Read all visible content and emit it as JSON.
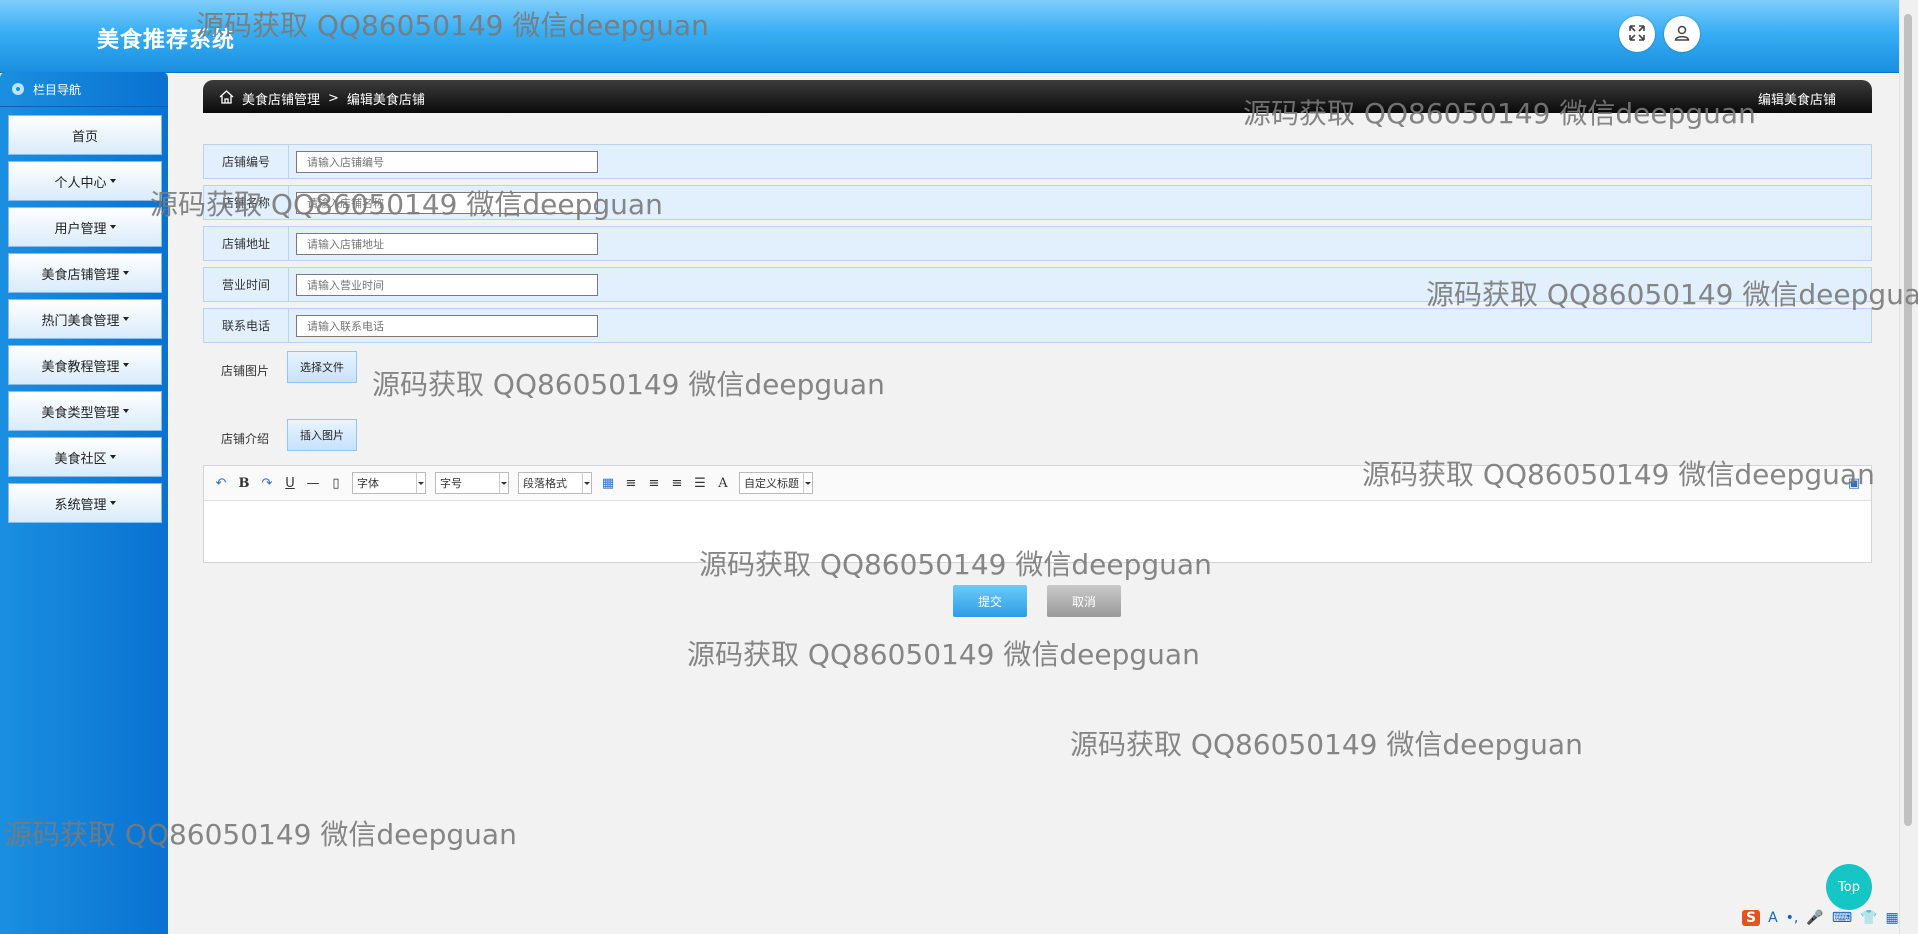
{
  "header": {
    "title": "美食推荐系统"
  },
  "sidebar": {
    "heading": "栏目导航",
    "items": [
      {
        "label": "首页",
        "dropdown": false
      },
      {
        "label": "个人中心",
        "dropdown": true
      },
      {
        "label": "用户管理",
        "dropdown": true
      },
      {
        "label": "美食店铺管理",
        "dropdown": true
      },
      {
        "label": "热门美食管理",
        "dropdown": true
      },
      {
        "label": "美食教程管理",
        "dropdown": true
      },
      {
        "label": "美食类型管理",
        "dropdown": true
      },
      {
        "label": "美食社区",
        "dropdown": true
      },
      {
        "label": "系统管理",
        "dropdown": true
      }
    ]
  },
  "breadcrumb": {
    "parent": "美食店铺管理",
    "separator": ">",
    "current": "编辑美食店铺",
    "right_title": "编辑美食店铺"
  },
  "form": {
    "fields": [
      {
        "label": "店铺编号",
        "placeholder": "请输入店铺编号",
        "value": ""
      },
      {
        "label": "店铺名称",
        "placeholder": "请输入店铺名称",
        "value": ""
      },
      {
        "label": "店铺地址",
        "placeholder": "请输入店铺地址",
        "value": ""
      },
      {
        "label": "营业时间",
        "placeholder": "请输入营业时间",
        "value": ""
      },
      {
        "label": "联系电话",
        "placeholder": "请输入联系电话",
        "value": ""
      }
    ],
    "image_label": "店铺图片",
    "image_button": "选择文件",
    "intro_label": "店铺介绍",
    "intro_button": "插入图片"
  },
  "editor": {
    "selects": {
      "font": "字体",
      "size": "字号",
      "paragraph": "段落格式",
      "custom": "自定义标题"
    },
    "content": ""
  },
  "actions": {
    "submit": "提交",
    "cancel": "取消"
  },
  "top_button": "Top",
  "watermark": "源码获取 QQ86050149 微信deepguan"
}
